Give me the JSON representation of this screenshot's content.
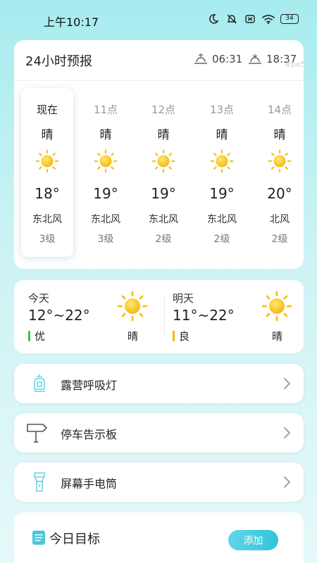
{
  "status_bar": {
    "time": "上午10:17",
    "battery": "34"
  },
  "forecast_24h": {
    "title": "24小时预报",
    "sunrise": "06:31",
    "sunset": "18:37",
    "watermark": "#be53",
    "hours": [
      {
        "time": "现在",
        "condition": "晴",
        "temp": "18°",
        "wind": "东北风",
        "level": "3级",
        "icon": "sun-icon"
      },
      {
        "time": "11点",
        "condition": "晴",
        "temp": "19°",
        "wind": "东北风",
        "level": "3级",
        "icon": "sun-icon"
      },
      {
        "time": "12点",
        "condition": "晴",
        "temp": "19°",
        "wind": "东北风",
        "level": "2级",
        "icon": "sun-icon"
      },
      {
        "time": "13点",
        "condition": "晴",
        "temp": "19°",
        "wind": "东北风",
        "level": "2级",
        "icon": "sun-icon"
      },
      {
        "time": "14点",
        "condition": "晴",
        "temp": "20°",
        "wind": "北风",
        "level": "2级",
        "icon": "sun-icon"
      }
    ]
  },
  "daily": {
    "today": {
      "label": "今天",
      "range": "12°~22°",
      "aqi": "优",
      "aqi_color": "#3ec24a",
      "condition": "晴"
    },
    "tomorrow": {
      "label": "明天",
      "range": "11°~22°",
      "aqi": "良",
      "aqi_color": "#f2b705",
      "condition": "晴"
    }
  },
  "menu": [
    {
      "label": "露营呼吸灯",
      "icon": "lantern-icon"
    },
    {
      "label": "停车告示板",
      "icon": "signpost-icon"
    },
    {
      "label": "屏幕手电筒",
      "icon": "flashlight-icon"
    }
  ],
  "goals": {
    "title": "今日目标",
    "add_label": "添加"
  },
  "colors": {
    "accent": "#34c3d9",
    "sun": "#f7c21a",
    "icon_line": "#6fd3df"
  }
}
